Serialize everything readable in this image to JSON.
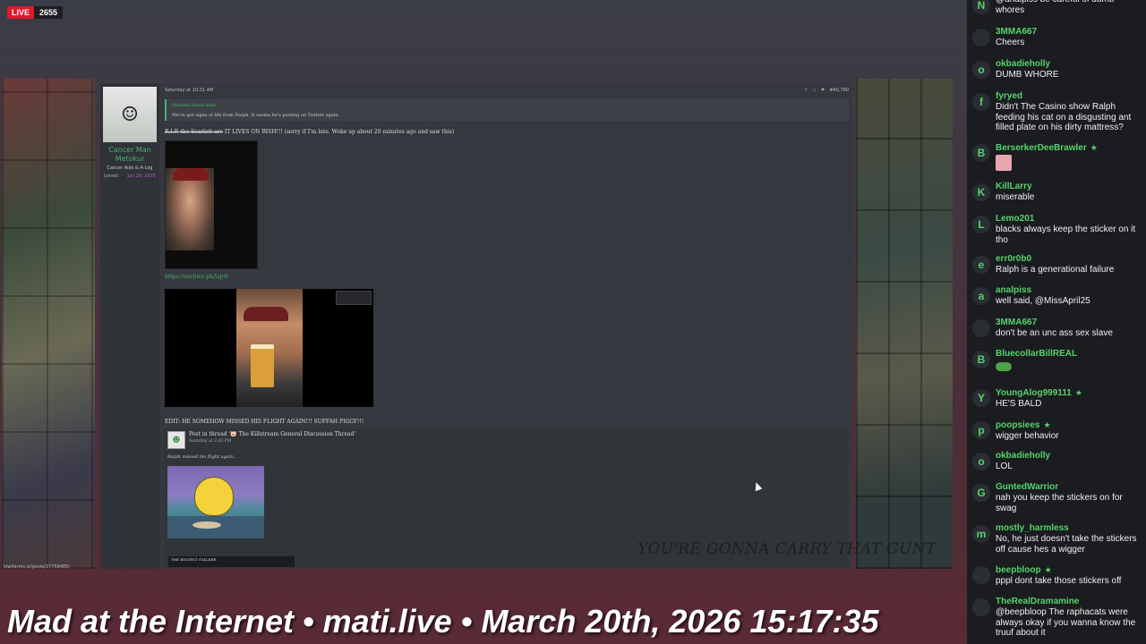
{
  "stream": {
    "live_label": "LIVE",
    "viewer_count": "2655",
    "title": "Mad at the Internet • mati.live • March 20th, 2026 15:17:35",
    "watermark": "YOU'RE GONNA CARRY THAT GUNT",
    "url_tag": "kiwifarms.st/posts/27759485/"
  },
  "forum": {
    "user": {
      "name": "Cancer Man Metokur",
      "title": "Cancer Aids & A-Log",
      "joined_label": "Joined:",
      "joined_value": "Jun 20, 2025"
    },
    "post": {
      "date": "Saturday at 10:31 AM",
      "post_number": "#40,790",
      "quote_author": "Persona Grata said:",
      "quote_text": "We've got signs of life from Ralph. It seems he's posting on Twitter again.",
      "line_strike": "R.I.P. the Scarlett arc",
      "line_rest": " IT LIVES ON BISH!!! (sorry if I'm late. Woke up about 20 minutes ago and saw this)",
      "archive_link": "https://archive.ph/Lqrti",
      "edit_line": "EDIT: HE SOMEHOW MISSED HIS FLIGHT AGAIN!!! SUFFAH PIGGY!!!",
      "thread_title": "Post in thread '🐷 The Killstream General Discussion Thread'",
      "thread_date": "Saturday at 2:42 PM",
      "thread_quote": "Ralph missed his flight again..",
      "stalker_label": "THE BIGGEST STALKER"
    }
  },
  "chat": [
    {
      "initial": "N",
      "name": "",
      "text": "@analpiss be careful of dumb whores",
      "star": false
    },
    {
      "initial": "",
      "name": "3MMA667",
      "text": "Cheers",
      "star": false
    },
    {
      "initial": "o",
      "name": "okbadieholly",
      "text": "DUMB WHORE",
      "star": false
    },
    {
      "initial": "f",
      "name": "fyryed",
      "text": "Didn't The Casino show Ralph feeding his cat on a disgusting ant filled plate on his dirty mattress?",
      "star": false
    },
    {
      "initial": "B",
      "name": "BerserkerDeeBrawler",
      "text": "",
      "star": true
    },
    {
      "initial": "K",
      "name": "KillLarry",
      "text": "miserable",
      "star": false
    },
    {
      "initial": "L",
      "name": "Lemo201",
      "text": "blacks always keep the sticker on it tho",
      "star": false
    },
    {
      "initial": "e",
      "name": "err0r0b0",
      "text": "Ralph is a generational failure",
      "star": false
    },
    {
      "initial": "a",
      "name": "analpiss",
      "text": "well said, @MissApril25",
      "star": false
    },
    {
      "initial": "",
      "name": "3MMA667",
      "text": "don't be an unc ass sex slave",
      "star": false
    },
    {
      "initial": "B",
      "name": "BluecollarBillREAL",
      "text": "",
      "star": false
    },
    {
      "initial": "Y",
      "name": "YoungAlog999111",
      "text": "HE'S BALD",
      "star": true
    },
    {
      "initial": "p",
      "name": "poopsiees",
      "text": "wigger behavior",
      "star": true
    },
    {
      "initial": "o",
      "name": "okbadieholly",
      "text": "LOL",
      "star": false
    },
    {
      "initial": "G",
      "name": "GuntedWarrior",
      "text": "nah you keep the stickers on for swag",
      "star": false
    },
    {
      "initial": "m",
      "name": "mostly_harmless",
      "text": "No, he just doesn't take the stickers off cause hes a wigger",
      "star": false
    },
    {
      "initial": "",
      "name": "beepbloop",
      "text": "pppl dont take those stickers off",
      "star": true
    },
    {
      "initial": "",
      "name": "TheRealDramamine",
      "text": "@beepbloop The raphacats were always okay if you wanna know the truuf about it",
      "star": false
    }
  ],
  "colors": {
    "accent_green": "#56d36b",
    "live_red": "#e0182d",
    "forum_bg": "#35393f"
  }
}
